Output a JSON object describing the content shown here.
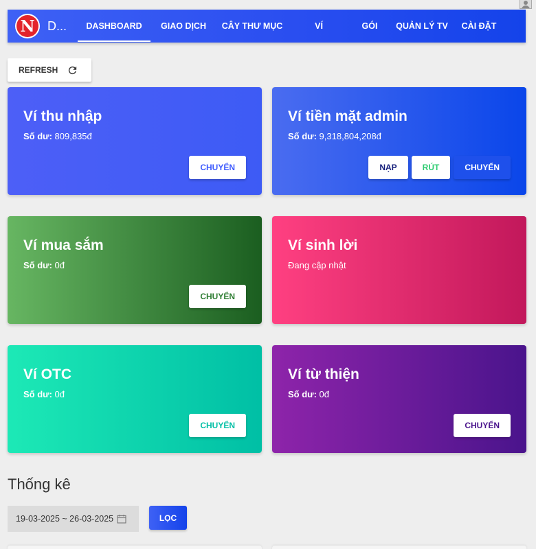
{
  "nav": {
    "brand": "D...",
    "items": [
      "DASHBOARD",
      "GIAO DỊCH",
      "CÂY THƯ MỤC",
      "VÍ",
      "GÓI",
      "QUẢN LÝ TV",
      "CÀI ĐẶT"
    ],
    "active_item": "DASHBOARD",
    "logo_letter": "N"
  },
  "toolbar": {
    "refresh_label": "REFRESH"
  },
  "wallets": [
    {
      "title": "Ví thu nhập",
      "balance_label": "Số dư:",
      "balance": "809,835đ",
      "actions": [
        {
          "label": "CHUYỂN",
          "color": "#3d5afe"
        }
      ]
    },
    {
      "title": "Ví tiền mặt admin",
      "balance_label": "Số dư:",
      "balance": "9,318,804,208đ",
      "actions": [
        {
          "label": "NẠP",
          "color": "#1a237e"
        },
        {
          "label": "RÚT",
          "color": "#2ecc71"
        },
        {
          "label": "CHUYỂN",
          "color": "#ffffff"
        }
      ]
    },
    {
      "title": "Ví mua sắm",
      "balance_label": "Số dư:",
      "balance": "0đ",
      "actions": [
        {
          "label": "CHUYỂN",
          "color": "#2e7d32"
        }
      ]
    },
    {
      "title": "Ví sinh lời",
      "status": "Đang cập nhật",
      "actions": []
    },
    {
      "title": "Ví OTC",
      "balance_label": "Số dư:",
      "balance": "0đ",
      "actions": [
        {
          "label": "CHUYỂN",
          "color": "#00bfa5"
        }
      ]
    },
    {
      "title": "Ví từ thiện",
      "balance_label": "Số dư:",
      "balance": "0đ",
      "actions": [
        {
          "label": "CHUYỂN",
          "color": "#4a148c"
        }
      ]
    }
  ],
  "stats": {
    "title": "Thống kê",
    "date_range": "19-03-2025 ~ 26-03-2025",
    "filter_label": "LỌC"
  }
}
